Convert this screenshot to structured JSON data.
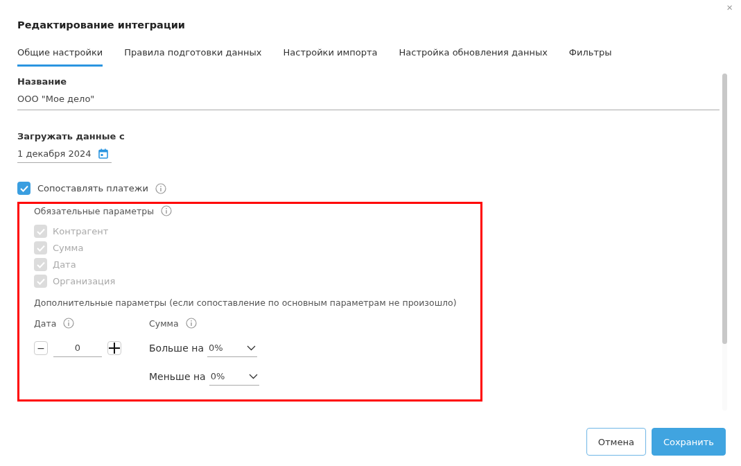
{
  "dialog": {
    "title": "Редактирование интеграции",
    "close": "×"
  },
  "tabs": [
    {
      "label": "Общие настройки",
      "selected": true
    },
    {
      "label": "Правила подготовки данных",
      "selected": false
    },
    {
      "label": "Настройки импорта",
      "selected": false
    },
    {
      "label": "Настройка обновления данных",
      "selected": false
    },
    {
      "label": "Фильтры",
      "selected": false
    }
  ],
  "name_field": {
    "label": "Название",
    "value": "ООО \"Мое дело\""
  },
  "date_field": {
    "label": "Загружать данные с",
    "value": "1 декабря 2024"
  },
  "match_payments": {
    "label": "Сопоставлять платежи",
    "checked": true
  },
  "required": {
    "title": "Обязательные параметры",
    "items": [
      {
        "label": "Контрагент",
        "checked": true,
        "disabled": true
      },
      {
        "label": "Сумма",
        "checked": true,
        "disabled": true
      },
      {
        "label": "Дата",
        "checked": true,
        "disabled": true
      },
      {
        "label": "Организация",
        "checked": true,
        "disabled": true
      }
    ]
  },
  "additional": {
    "title": "Дополнительные параметры (если сопоставление по основным параметрам не произошло)",
    "date": {
      "label": "Дата",
      "minus": "−",
      "value": "0"
    },
    "sum": {
      "label": "Сумма",
      "rows": [
        {
          "label": "Больше на",
          "value": "0%"
        },
        {
          "label": "Меньше на",
          "value": "0%"
        }
      ]
    }
  },
  "buttons": [
    {
      "label": "Отмена",
      "kind": "secondary"
    },
    {
      "label": "Сохранить",
      "kind": "primary"
    }
  ]
}
